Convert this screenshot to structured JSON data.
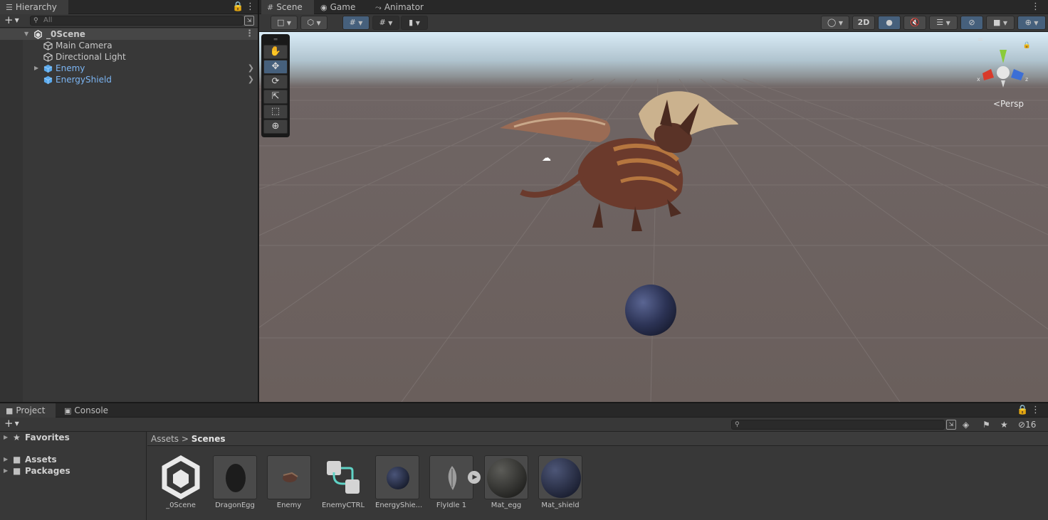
{
  "hierarchy": {
    "tab_label": "Hierarchy",
    "search_placeholder": "All",
    "scene_name": "_0Scene",
    "items": [
      {
        "label": "Main Camera",
        "prefab": false
      },
      {
        "label": "Directional Light",
        "prefab": false
      },
      {
        "label": "Enemy",
        "prefab": true
      },
      {
        "label": "EnergyShield",
        "prefab": true
      }
    ]
  },
  "scene_panel": {
    "tabs": [
      {
        "label": "Scene",
        "icon": "grid-icon",
        "active": true
      },
      {
        "label": "Game",
        "icon": "gamepad-icon",
        "active": false
      },
      {
        "label": "Animator",
        "icon": "animator-icon",
        "active": false
      }
    ],
    "toolbar": {
      "mode_2d_label": "2D",
      "active_color": "#46607c"
    },
    "view_label": "Persp",
    "tools": [
      "hand-tool",
      "move-tool",
      "rotate-tool",
      "scale-tool",
      "rect-tool",
      "transform-tool"
    ],
    "active_tool": "move-tool",
    "gizmo_axes": {
      "x": "x",
      "z": "z"
    }
  },
  "bottom_panel": {
    "tabs": [
      {
        "label": "Project",
        "active": true
      },
      {
        "label": "Console",
        "active": false
      }
    ],
    "hidden_count": "16",
    "sidebar": [
      {
        "label": "Favorites",
        "icon": "star-icon"
      },
      {
        "label": "Assets",
        "icon": "folder-icon"
      },
      {
        "label": "Packages",
        "icon": "folder-icon"
      }
    ],
    "breadcrumb": {
      "root": "Assets",
      "current": "Scenes"
    },
    "assets": [
      {
        "name": "_0Scene",
        "type": "scene"
      },
      {
        "name": "DragonEgg",
        "type": "mesh"
      },
      {
        "name": "Enemy",
        "type": "prefab"
      },
      {
        "name": "EnemyCTRL",
        "type": "animator-controller"
      },
      {
        "name": "EnergyShie...",
        "type": "prefab"
      },
      {
        "name": "FlyIdle 1",
        "type": "animation"
      },
      {
        "name": "Mat_egg",
        "type": "material"
      },
      {
        "name": "Mat_shield",
        "type": "material"
      }
    ]
  }
}
